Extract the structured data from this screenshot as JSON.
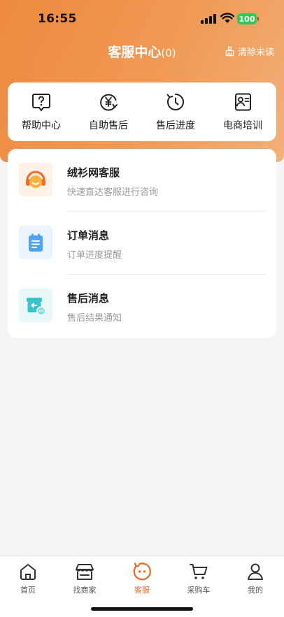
{
  "status_bar": {
    "time": "16:55",
    "battery": "100"
  },
  "header": {
    "title": "客服中心",
    "count": "(0)",
    "clear_unread": "清除未读"
  },
  "quick_actions": [
    {
      "label": "帮助中心",
      "icon": "help-question-icon"
    },
    {
      "label": "自助售后",
      "icon": "yen-refund-icon"
    },
    {
      "label": "售后进度",
      "icon": "clock-progress-icon"
    },
    {
      "label": "电商培训",
      "icon": "training-id-icon"
    }
  ],
  "messages": [
    {
      "title": "绒衫网客服",
      "subtitle": "快速直达客服进行咨询",
      "icon": "headset-service-icon",
      "icon_bg": "#fff1e6"
    },
    {
      "title": "订单消息",
      "subtitle": "订单进度提醒",
      "icon": "clipboard-order-icon",
      "icon_bg": "#eaf3fe"
    },
    {
      "title": "售后消息",
      "subtitle": "售后结果通知",
      "icon": "refund-box-icon",
      "icon_bg": "#e8f8f8"
    }
  ],
  "tabbar": [
    {
      "label": "首页",
      "icon": "home-icon",
      "active": false
    },
    {
      "label": "找商家",
      "icon": "shop-icon",
      "active": false
    },
    {
      "label": "客服",
      "icon": "service-face-icon",
      "active": true
    },
    {
      "label": "采购车",
      "icon": "cart-icon",
      "active": false
    },
    {
      "label": "我的",
      "icon": "user-icon",
      "active": false
    }
  ],
  "colors": {
    "accent": "#e8692a",
    "header_start": "#ee8a40",
    "header_end": "#f2b07a"
  }
}
